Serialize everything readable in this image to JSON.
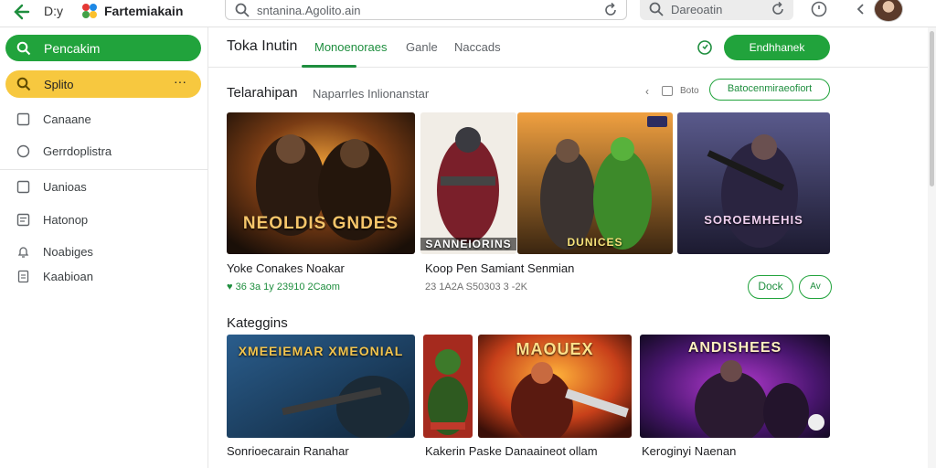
{
  "topbar": {
    "app_name": "D:y",
    "brand": "Fartemiakain",
    "search_text": "sntanina.Agolito.ain",
    "search_small_text": "Dareoatin"
  },
  "sidebar": {
    "primary": "Pencakim",
    "active": "Splito",
    "active_more": "···",
    "items": [
      {
        "label": "Canaane",
        "icon": "square-icon"
      },
      {
        "label": "Gerrdoplistra",
        "icon": "circle-icon"
      },
      {
        "label": "Uanioas",
        "icon": "square-icon"
      },
      {
        "label": "Hatonop",
        "icon": "list-icon"
      },
      {
        "label": "Noabiges",
        "icon": "bell-icon"
      },
      {
        "label": "Kaabioan",
        "icon": "document-icon"
      }
    ]
  },
  "tabs": {
    "title": "Toka Inutin",
    "items": [
      "Monoenoraes",
      "Ganle",
      "Naccads"
    ],
    "cta": "Endhhanek"
  },
  "featured": {
    "title": "Telarahipan",
    "subtitle": "Naparrles Inlionanstar",
    "pager_text": "Boto",
    "action_button": "Batocenmiraeofiort",
    "cards": [
      {
        "caption": "NEOLDIS GNDES"
      },
      {
        "caption": "SANNEIORINS"
      },
      {
        "caption": "DUNICES"
      },
      {
        "caption": "SOROEMHEHIS"
      }
    ],
    "game1_title": "Yoke Conakes Noakar",
    "game1_meta": "36 3a 1y  23910 2Caom",
    "game2_title": "Koop Pen Samiant Senmian",
    "game2_meta": "23 1A2A  S50303 3 -2K",
    "btn_dock": "Dock",
    "btn_small": "Av"
  },
  "categories": {
    "title": "Kateggins",
    "cards": [
      {
        "caption": "XMEEIEMAR XMEONIAL"
      },
      {
        "caption": ""
      },
      {
        "caption": "MAOUEX"
      },
      {
        "caption": "ANDISHEES"
      }
    ],
    "titles": [
      "Sonrioecarain Ranahar",
      "Kakerin Paske Danaaineot ollam",
      "Keroginyi Naenan"
    ]
  },
  "colors": {
    "accent_green": "#21a33c",
    "accent_yellow": "#f7c83f",
    "text_dark": "#202124",
    "text_gray": "#5f6368"
  }
}
